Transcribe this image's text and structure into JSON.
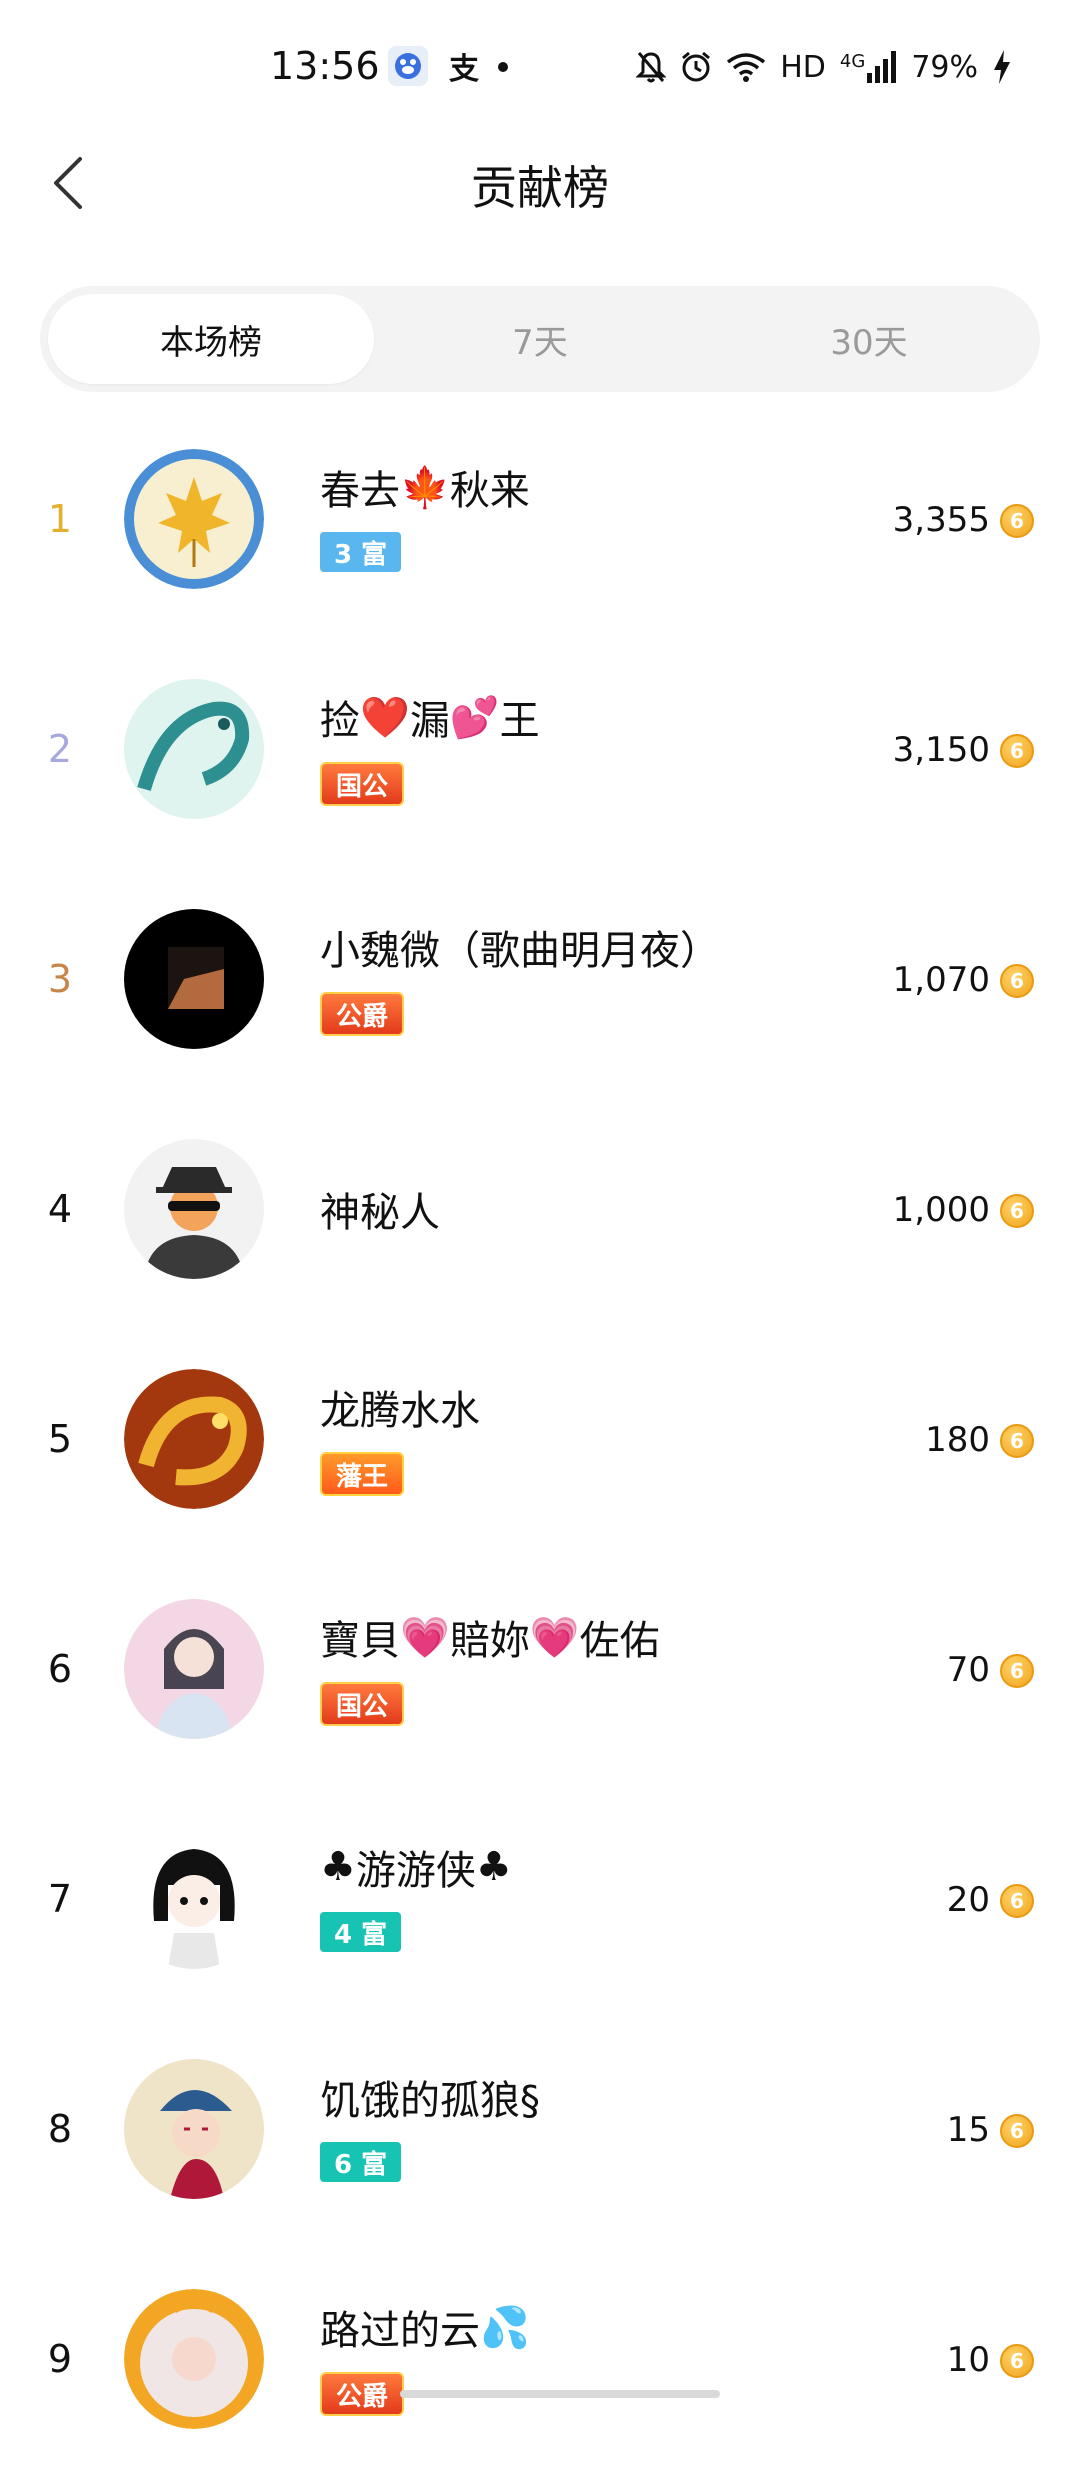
{
  "status_bar": {
    "time": "13:56",
    "network": "HD",
    "signal": "4G",
    "battery": "79%"
  },
  "header": {
    "title": "贡献榜",
    "back_icon": "chevron-left-icon"
  },
  "tabs": [
    {
      "label": "本场榜",
      "active": true
    },
    {
      "label": "7天",
      "active": false
    },
    {
      "label": "30天",
      "active": false
    }
  ],
  "colors": {
    "rank1": "#e2b22f",
    "rank2": "#a8a8e0",
    "rank3": "#c9844a",
    "rank_default": "#111111",
    "coin": "#f0a419"
  },
  "list": [
    {
      "rank": "1",
      "name_parts": [
        "春去",
        "🍁",
        "秋来"
      ],
      "badge": "3 富",
      "score": "3,355"
    },
    {
      "rank": "2",
      "name_parts": [
        "捡",
        "❤️",
        "漏",
        "💕",
        "王"
      ],
      "badge": "国公",
      "score": "3,150"
    },
    {
      "rank": "3",
      "name_parts": [
        "小魏微（歌曲明月夜）"
      ],
      "badge": "公爵",
      "score": "1,070"
    },
    {
      "rank": "4",
      "name_parts": [
        "神秘人"
      ],
      "badge": "",
      "score": "1,000"
    },
    {
      "rank": "5",
      "name_parts": [
        "龙腾水水"
      ],
      "badge": "藩王",
      "score": "180"
    },
    {
      "rank": "6",
      "name_parts": [
        "寶貝",
        "💗",
        "賠妳",
        "💗",
        "佐佑"
      ],
      "badge": "国公",
      "score": "70"
    },
    {
      "rank": "7",
      "name_parts": [
        "♣",
        "游游侠",
        "♣"
      ],
      "badge": "4 富",
      "score": "20"
    },
    {
      "rank": "8",
      "name_parts": [
        "饥饿的孤狼§"
      ],
      "badge": "6 富",
      "score": "15"
    },
    {
      "rank": "9",
      "name_parts": [
        "路过的云",
        "💦"
      ],
      "badge": "公爵",
      "score": "10"
    }
  ]
}
